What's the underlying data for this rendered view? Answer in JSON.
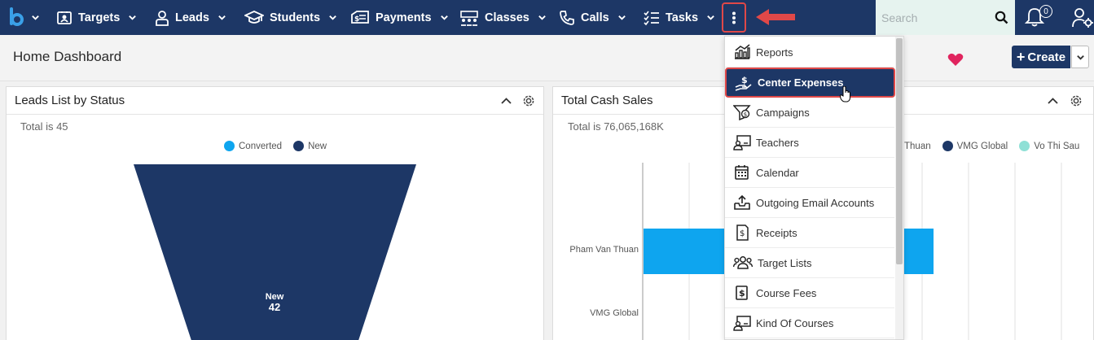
{
  "colors": {
    "nav_bg": "#1d3766",
    "accent_red": "#e04848",
    "converted": "#0ea5ef",
    "new": "#1d3766",
    "vo_thi_sau": "#8fe0d6",
    "heart": "#e0245e"
  },
  "nav": {
    "logo_icon": "brand-b-logo",
    "items": [
      {
        "label": "Targets",
        "icon": "target-board-icon"
      },
      {
        "label": "Leads",
        "icon": "person-icon"
      },
      {
        "label": "Students",
        "icon": "graduation-cap-icon"
      },
      {
        "label": "Payments",
        "icon": "payment-icon"
      },
      {
        "label": "Classes",
        "icon": "classroom-icon"
      },
      {
        "label": "Calls",
        "icon": "phone-icon"
      },
      {
        "label": "Tasks",
        "icon": "checklist-icon"
      }
    ],
    "more_icon": "vertical-dots-icon",
    "search_placeholder": "Search",
    "notification_count": "0"
  },
  "header": {
    "page_title": "Home Dashboard",
    "create_label": "Create"
  },
  "leads_panel": {
    "title": "Leads List by Status",
    "total": "Total is 45",
    "legend": [
      "Converted",
      "New"
    ],
    "funnel_label": "New",
    "funnel_value": "42"
  },
  "cash_panel": {
    "title": "Total Cash Sales",
    "total": "Total is 76,065,168K",
    "legend": [
      "Thuan",
      "VMG Global",
      "Vo Thi Sau"
    ],
    "bar_labels": [
      "Pham Van Thuan",
      "VMG Global"
    ]
  },
  "dropdown": {
    "items": [
      {
        "label": "Reports",
        "icon": "reports-chart-icon"
      },
      {
        "label": "Center Expenses",
        "icon": "hand-money-icon",
        "active": true
      },
      {
        "label": "Campaigns",
        "icon": "campaign-icon"
      },
      {
        "label": "Teachers",
        "icon": "teacher-board-icon"
      },
      {
        "label": "Calendar",
        "icon": "calendar-icon"
      },
      {
        "label": "Outgoing Email Accounts",
        "icon": "email-outbox-icon"
      },
      {
        "label": "Receipts",
        "icon": "receipt-icon"
      },
      {
        "label": "Target Lists",
        "icon": "group-icon"
      },
      {
        "label": "Course Fees",
        "icon": "dollar-doc-icon"
      },
      {
        "label": "Kind Of Courses",
        "icon": "course-board-icon"
      }
    ]
  }
}
